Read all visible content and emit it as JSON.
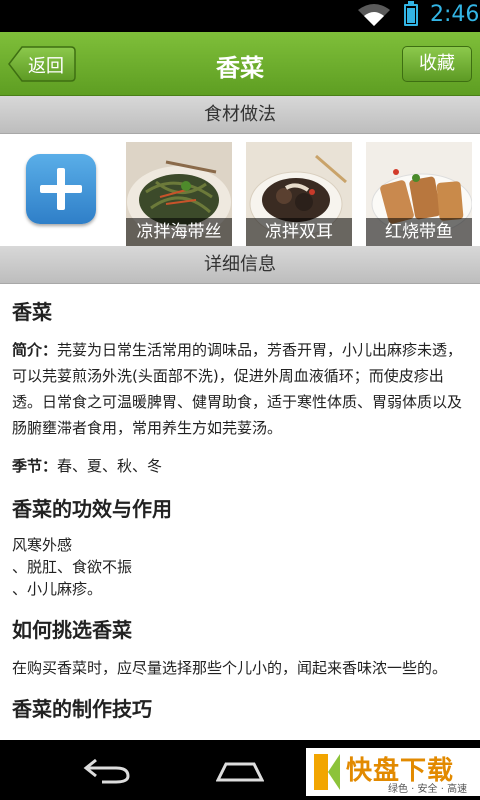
{
  "status_bar": {
    "time": "2:46"
  },
  "header": {
    "back_label": "返回",
    "title": "香菜",
    "favorite_label": "收藏"
  },
  "sections": {
    "recipes_title": "食材做法",
    "details_title": "详细信息"
  },
  "recipes": [
    {
      "name": "凉拌海带丝"
    },
    {
      "name": "凉拌双耳"
    },
    {
      "name": "红烧带鱼"
    }
  ],
  "detail": {
    "name": "香菜",
    "intro_label": "简介：",
    "intro_text": "芫荽为日常生活常用的调味品，芳香开胃，小儿出麻疹未透，可以芫荽煎汤外洗(头面部不洗)，促进外周血液循环；而使皮疹出透。日常食之可温暖脾胃、健胃助食，适于寒性体质、胃弱体质以及肠腑壅滞者食用，常用养生方如芫荽汤。",
    "season_label": "季节：",
    "season_text": "春、夏、秋、冬",
    "effects_title": "香菜的功效与作用",
    "effects_lines": [
      "风寒外感",
      "、脱肛、食欲不振",
      "、小儿麻疹。"
    ],
    "choose_title": "如何挑选香菜",
    "choose_text": "在购买香菜时，应尽量选择那些个儿小的，闻起来香味浓一些的。",
    "tips_title": "香菜的制作技巧"
  },
  "watermark": {
    "big": "快盘下载",
    "small": "绿色 · 安全 · 高速"
  }
}
